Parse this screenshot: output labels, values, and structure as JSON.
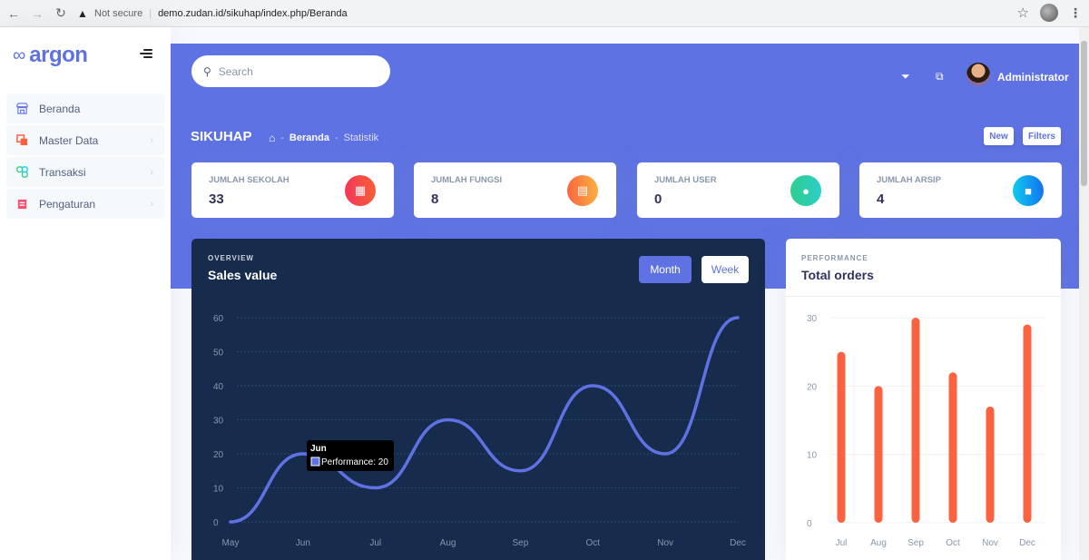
{
  "browser": {
    "back_icon": "arrow-left",
    "forward_icon": "arrow-right",
    "reload_icon": "reload",
    "security_text": "Not secure",
    "url": "demo.zudan.id/sikuhap/index.php/Beranda"
  },
  "sidebar": {
    "brand": "argon",
    "items": [
      {
        "label": "Beranda",
        "icon": "shop-icon",
        "color": "#5e72e4",
        "has_submenu": false
      },
      {
        "label": "Master Data",
        "icon": "folder-icon",
        "color": "#fb6340",
        "has_submenu": true
      },
      {
        "label": "Transaksi",
        "icon": "transaction-icon",
        "color": "#2dce89",
        "has_submenu": true
      },
      {
        "label": "Pengaturan",
        "icon": "settings-icon",
        "color": "#f5365c",
        "has_submenu": true
      }
    ]
  },
  "header": {
    "search_placeholder": "Search",
    "username": "Administrator",
    "page_title": "SIKUHAP",
    "breadcrumb": [
      "Beranda",
      "Statistik"
    ],
    "buttons": {
      "new": "New",
      "filters": "Filters"
    },
    "accent": "#5e72e4"
  },
  "stats": [
    {
      "label": "JUMLAH SEKOLAH",
      "value": "33",
      "icon": "school-icon",
      "color": "#f5365c"
    },
    {
      "label": "JUMLAH FUNGSI",
      "value": "8",
      "icon": "folder-icon",
      "color": "#fb6340"
    },
    {
      "label": "JUMLAH USER",
      "value": "0",
      "icon": "user-icon",
      "color": "#2dce89"
    },
    {
      "label": "JUMLAH ARSIP",
      "value": "4",
      "icon": "book-icon",
      "color": "#11cdef"
    }
  ],
  "sales_card": {
    "overline": "OVERVIEW",
    "title": "Sales value",
    "tabs": {
      "month": "Month",
      "week": "Week"
    },
    "tooltip": {
      "title": "Jun",
      "text": "Performance: 20"
    }
  },
  "orders_card": {
    "overline": "PERFORMANCE",
    "title": "Total orders"
  },
  "chart_data": [
    {
      "type": "line",
      "title": "Sales value",
      "categories": [
        "May",
        "Jun",
        "Jul",
        "Aug",
        "Sep",
        "Oct",
        "Nov",
        "Dec"
      ],
      "series": [
        {
          "name": "Performance",
          "values": [
            0,
            20,
            10,
            30,
            15,
            40,
            20,
            60
          ]
        }
      ],
      "ylim": [
        0,
        60
      ],
      "yticks": [
        0,
        10,
        20,
        30,
        40,
        50,
        60
      ],
      "grid": true,
      "line_color": "#5e72e4"
    },
    {
      "type": "bar",
      "title": "Total orders",
      "categories": [
        "Jul",
        "Aug",
        "Sep",
        "Oct",
        "Nov",
        "Dec"
      ],
      "values": [
        25,
        20,
        30,
        22,
        17,
        29
      ],
      "ylim": [
        0,
        30
      ],
      "yticks": [
        0,
        10,
        20,
        30
      ],
      "grid": true,
      "bar_color": "#fb6340"
    }
  ]
}
